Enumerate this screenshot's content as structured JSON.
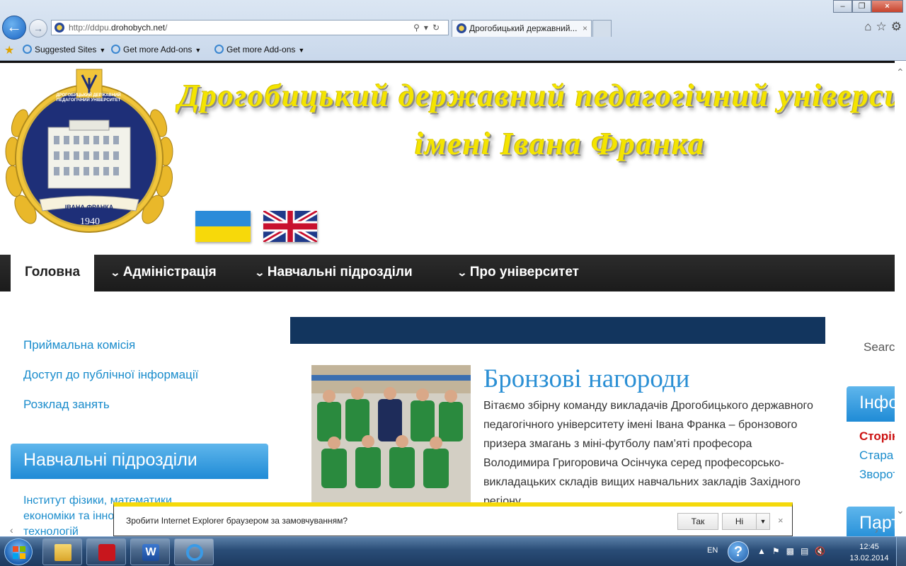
{
  "browser": {
    "url_prefix": "http://ddpu.",
    "url_domain": "drohobych.net",
    "url_suffix": "/",
    "tab_title": "Дрогобицький державний...",
    "favorites": [
      {
        "label": "Suggested Sites"
      },
      {
        "label": "Get more Add-ons"
      },
      {
        "label": "Get more Add-ons"
      }
    ]
  },
  "header": {
    "banner_line1": "Дрогобицький державний педагогічний університет",
    "banner_line2": "імені Івана Франка",
    "seal_text": "ДРОГОБИЦЬКИЙ ДЕРЖАВНИЙ ПЕДАГОГІЧНИЙ УНІВЕРСИТЕТ",
    "seal_name": "ІВАНА ФРАНКА",
    "seal_year": "1940"
  },
  "nav": {
    "items": [
      {
        "label": "Головна"
      },
      {
        "label": "Адміністрація"
      },
      {
        "label": "Навчальні підрозділи"
      },
      {
        "label": "Про університет"
      }
    ]
  },
  "sidebar_left": {
    "links": [
      {
        "label": "Приймальна комісія"
      },
      {
        "label": "Доступ до публічної інформації"
      },
      {
        "label": "Розклад занять"
      }
    ],
    "box_title": "Навчальні підрозділи",
    "box_item": "Інститут фізики, математики, економіки та інноваційних технологій"
  },
  "article": {
    "title": "Бронзові нагороди",
    "body": "Вітаємо збірну команду викладачів Дрогобицького державного педагогічного університету імені Івана Франка  – бронзового призера змагань з міні-футболу пам’яті професора Володимира Григоровича Осінчука серед професорсько-викладацьких складів вищих навчальних закладів Західного регіону"
  },
  "sidebar_right": {
    "search_label": "Search",
    "box_title": "Інформація",
    "links": [
      {
        "label": "Сторінка"
      },
      {
        "label": "Стара версія"
      },
      {
        "label": "Зворотній зв'язок"
      }
    ],
    "box2_title": "Партнери"
  },
  "notification": {
    "text": "Зробити Internet Explorer браузером за замовчуванням?",
    "yes": "Так",
    "no": "Ні",
    "close": "×"
  },
  "taskbar": {
    "lang": "EN",
    "time": "12:45",
    "date": "13.02.2014"
  },
  "colors": {
    "accent_blue": "#1f8bd6",
    "nav_dark": "#1b1b1b",
    "article_title": "#2a8fd4",
    "banner_yellow": "#f4e400",
    "dark_bar": "#12355e"
  }
}
